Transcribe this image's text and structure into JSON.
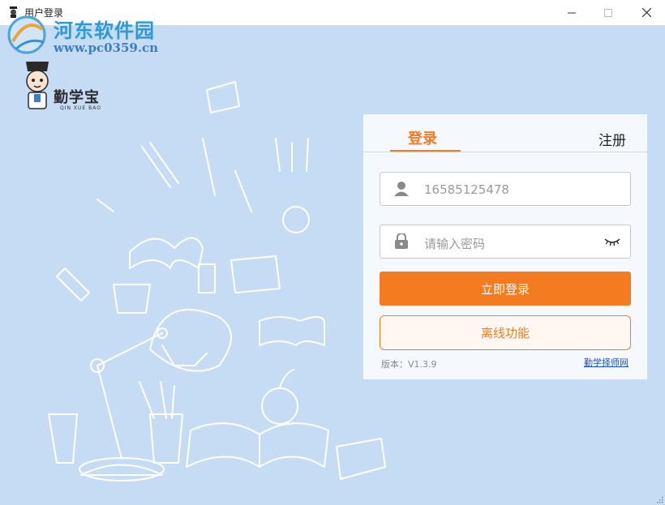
{
  "window": {
    "title": "用户登录",
    "icons": {
      "app": "graduate-icon",
      "minimize": "minimize-icon",
      "maximize": "maximize-icon",
      "close": "close-icon"
    }
  },
  "watermark": {
    "site_name": "河东软件园",
    "url": "www.pc0359.cn"
  },
  "brand": {
    "name": "勤学宝",
    "subtitle": "QIN XUE BAO"
  },
  "login_panel": {
    "tabs": {
      "login": "登录",
      "register": "注册"
    },
    "phone_field": {
      "value": "16585125478",
      "icon": "user-icon"
    },
    "password_field": {
      "placeholder": "请输入密码",
      "icon": "lock-icon",
      "toggle_icon": "eye-closed-icon"
    },
    "login_button": "立即登录",
    "offline_button": "离线功能",
    "version": "版本：V1.3.9",
    "site_link": "勤学择师网"
  },
  "colors": {
    "accent": "#f47b20",
    "background": "#c6dcf5",
    "panel": "#f5f9fe",
    "link": "#1e4fbf"
  }
}
